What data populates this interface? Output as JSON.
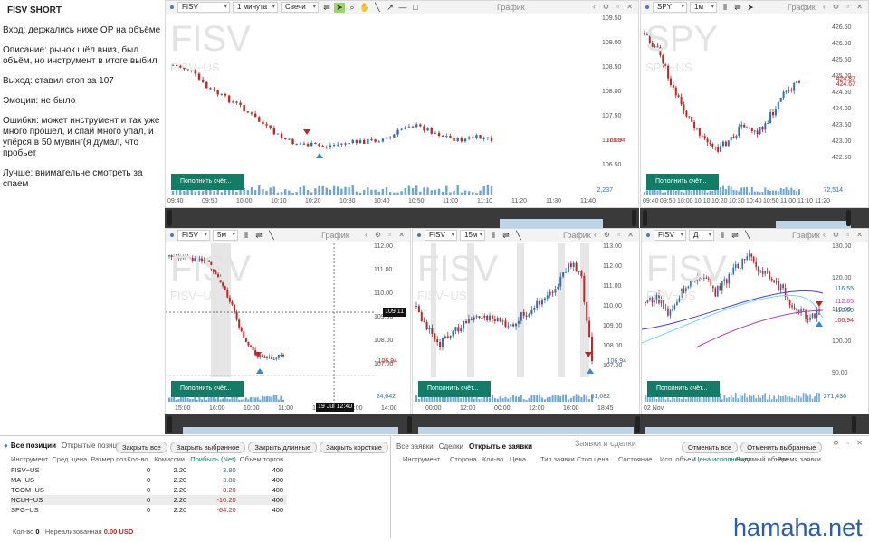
{
  "notes": {
    "title": "FISV SHORT",
    "lines": [
      "Вход: держались ниже ОР на объёме",
      "Описание: рынок шёл вниз, был объём, но инструмент в итоге выбил",
      "Выход: ставил стоп за 107",
      "Эмоции: не было",
      "Ошибки: может инструмент и так уже много прошёл, и спай много упал, и упёрся в 50 мувинг(я думал, что пробьет",
      "Лучше: внимательне смотреть за спаем"
    ]
  },
  "chart_main": {
    "symbol": "FISV",
    "interval": "1 минута",
    "style": "Свечи",
    "title": "График",
    "watermark": "FISV",
    "watermark_sub": "FISV~US",
    "y_ticks": [
      "109.50",
      "109.00",
      "108.50",
      "108.00",
      "107.50",
      "107.00",
      "106.50"
    ],
    "price_label": "106.94",
    "x_ticks": [
      "09:40",
      "09:50",
      "10:00",
      "10:10",
      "10:20",
      "10:30",
      "10:40",
      "10:50",
      "11:00",
      "11:10",
      "11:20",
      "11:30",
      "11:40"
    ],
    "volume": "2,237",
    "fund_button": "Пополнить счёт..."
  },
  "chart_spy": {
    "symbol": "SPY",
    "interval": "1м",
    "title": "График",
    "watermark": "SPY",
    "watermark_sub": "SPY~US",
    "y_ticks": [
      "426.50",
      "426.00",
      "425.50",
      "425.00",
      "424.50",
      "424.00",
      "423.50",
      "423.00",
      "422.50"
    ],
    "price_labels": [
      "424.87",
      "424.67"
    ],
    "x_ticks": [
      "09:40",
      "09:50",
      "10:00",
      "10:10",
      "10:20",
      "10:30",
      "10:40",
      "10:50",
      "11:00",
      "11:10",
      "11:20"
    ],
    "volume": "72,514",
    "fund_button": "Пополнить счёт..."
  },
  "chart_5m": {
    "symbol": "FISV",
    "interval": "5м",
    "title": "График",
    "watermark": "FISV",
    "watermark_sub": "FISV~US",
    "y_ticks": [
      "112.00",
      "111.00",
      "110.00",
      "109.00",
      "108.00",
      "107.00"
    ],
    "price_labels": [
      "109.11",
      "106.94"
    ],
    "x_ticks": [
      "15:00",
      "16:00",
      "10:00",
      "11:00",
      "12:00",
      "13:00",
      "14:00"
    ],
    "crosshair_label": "19 Jul 12:40",
    "volume": "24,642",
    "fund_button": "Пополнить счёт..."
  },
  "chart_15m": {
    "symbol": "FISV",
    "interval": "15м",
    "title": "График",
    "watermark": "FISV",
    "watermark_sub": "FISV~US",
    "y_ticks": [
      "113.00",
      "112.00",
      "111.00",
      "110.00",
      "109.00",
      "108.00",
      "107.00"
    ],
    "price_label": "106.94",
    "x_ticks": [
      "00:00",
      "12:00",
      "00:00",
      "12:00",
      "16:00",
      "18:45"
    ],
    "volume": "61,682",
    "fund_button": "Пополнить счёт..."
  },
  "chart_d": {
    "symbol": "FISV",
    "interval": "Д",
    "title": "График",
    "watermark": "FISV",
    "watermark_sub": "FISV~US",
    "y_ticks": [
      "130.00",
      "120.00",
      "110.00",
      "100.00",
      "90.00"
    ],
    "price_labels": [
      "116.55",
      "112.65",
      "110.00",
      "106.94"
    ],
    "x_ticks": [
      "02 Nov"
    ],
    "volume": "271,436",
    "fund_button": "Пополнить счёт..."
  },
  "positions": {
    "tabs": [
      "Все позиции",
      "Открытые позиции"
    ],
    "buttons": [
      "Закрыть все",
      "Закрыть выбранное",
      "Закрыть длинные",
      "Закрыть короткие"
    ],
    "columns": [
      "Инструмент",
      "Сред. цена",
      "Размер позиции",
      "Кол-во",
      "Комиссии",
      "Прибыль (Net)",
      "Объем торгов"
    ],
    "rows": [
      {
        "inst": "FISV~US",
        "avg": "",
        "size": "",
        "qty": "0",
        "comm": "2.20",
        "pnl": "3.80",
        "vol": "400"
      },
      {
        "inst": "MA~US",
        "avg": "",
        "size": "",
        "qty": "0",
        "comm": "2.20",
        "pnl": "3.80",
        "vol": "400"
      },
      {
        "inst": "TCOM~US",
        "avg": "",
        "size": "",
        "qty": "0",
        "comm": "2.20",
        "pnl": "-8.20",
        "vol": "400"
      },
      {
        "inst": "NCLH~US",
        "avg": "",
        "size": "",
        "qty": "0",
        "comm": "2.20",
        "pnl": "-10.20",
        "vol": "400"
      },
      {
        "inst": "SPG~US",
        "avg": "",
        "size": "",
        "qty": "0",
        "comm": "2.20",
        "pnl": "-64.20",
        "vol": "400"
      }
    ],
    "footer_qty_label": "Кол-во",
    "footer_qty": "0",
    "footer_unreal_label": "Нереализованная",
    "footer_unreal": "0.00 USD"
  },
  "orders": {
    "tabs": [
      "Все заявки",
      "Сделки",
      "Открытые заявки"
    ],
    "title": "Заявки и сделки",
    "buttons": [
      "Отменить все",
      "Отменить выбранные"
    ],
    "columns": [
      "Инструмент",
      "Сторона",
      "Кол-во",
      "Цена",
      "Тип заявки",
      "Стоп цена",
      "Состояние",
      "Исп. объем",
      "Цена исполнения",
      "Видимый объем",
      "Время заявки"
    ]
  },
  "watermark_site": "hamaha.net",
  "colors": {
    "up": "#2e6fb5",
    "down": "#c32424",
    "accent": "#137c66",
    "volume": "#6aa6d6"
  }
}
